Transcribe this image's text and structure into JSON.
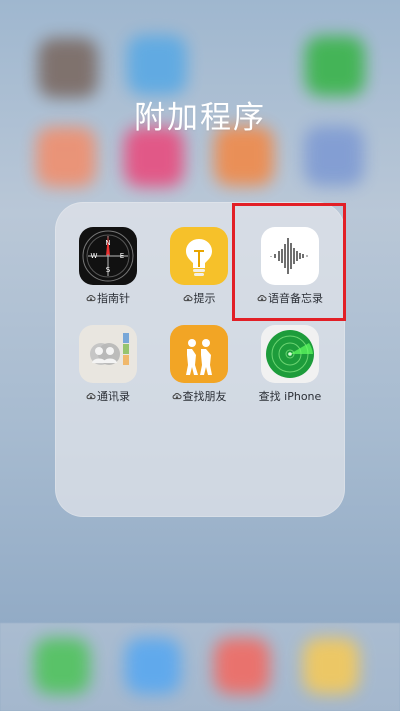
{
  "folder": {
    "title": "附加程序"
  },
  "apps": [
    {
      "name": "compass",
      "label": "指南针",
      "cloud": true
    },
    {
      "name": "tips",
      "label": "提示",
      "cloud": true
    },
    {
      "name": "voice-memos",
      "label": "语音备忘录",
      "cloud": true,
      "highlighted": true
    },
    {
      "name": "contacts",
      "label": "通讯录",
      "cloud": true
    },
    {
      "name": "find-friends",
      "label": "查找朋友",
      "cloud": true
    },
    {
      "name": "find-iphone",
      "label": "查找 iPhone",
      "cloud": false
    }
  ],
  "compass": {
    "n": "N",
    "e": "E",
    "s": "S",
    "w": "W"
  },
  "colors": {
    "highlight": "#e21f26",
    "tips_yellow": "#f6c12a",
    "find_friends_orange": "#f2a525",
    "find_iphone_green": "#1d9c3b"
  },
  "icons": {
    "cloud": "cloud-download-icon",
    "compass": "compass-icon",
    "tips": "lightbulb-icon",
    "voice_memos": "waveform-icon",
    "contacts": "contacts-icon",
    "find_friends": "people-icon",
    "find_iphone": "radar-icon"
  }
}
